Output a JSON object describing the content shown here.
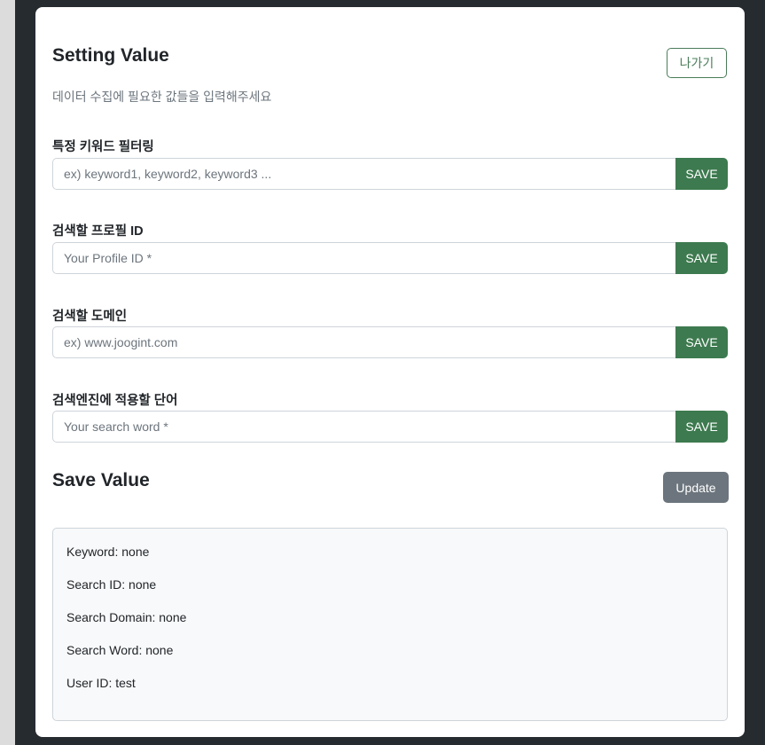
{
  "header": {
    "title": "Setting Value",
    "exit_label": "나가기",
    "subtitle": "데이터 수집에 필요한 값들을 입력해주세요"
  },
  "fields": [
    {
      "label": "특정 키워드 필터링",
      "value": "",
      "placeholder": "ex) keyword1, keyword2, keyword3 ...",
      "button": "SAVE"
    },
    {
      "label": "검색할 프로필 ID",
      "value": "",
      "placeholder": "Your Profile ID *",
      "button": "SAVE"
    },
    {
      "label": "검색할 도메인",
      "value": "",
      "placeholder": "ex) www.joogint.com",
      "button": "SAVE"
    },
    {
      "label": "검색엔진에 적용할 단어",
      "value": "",
      "placeholder": "Your search word *",
      "button": "SAVE"
    }
  ],
  "saved": {
    "title": "Save Value",
    "update_label": "Update",
    "lines": [
      "Keyword: none",
      "Search ID: none",
      "Search Domain: none",
      "Search Word: none",
      "User ID: test"
    ]
  },
  "colors": {
    "accent_green": "#3d7a4f",
    "outline_green": "#4a7c59",
    "update_gray": "#6c757d",
    "frame_dark": "#262b30"
  }
}
